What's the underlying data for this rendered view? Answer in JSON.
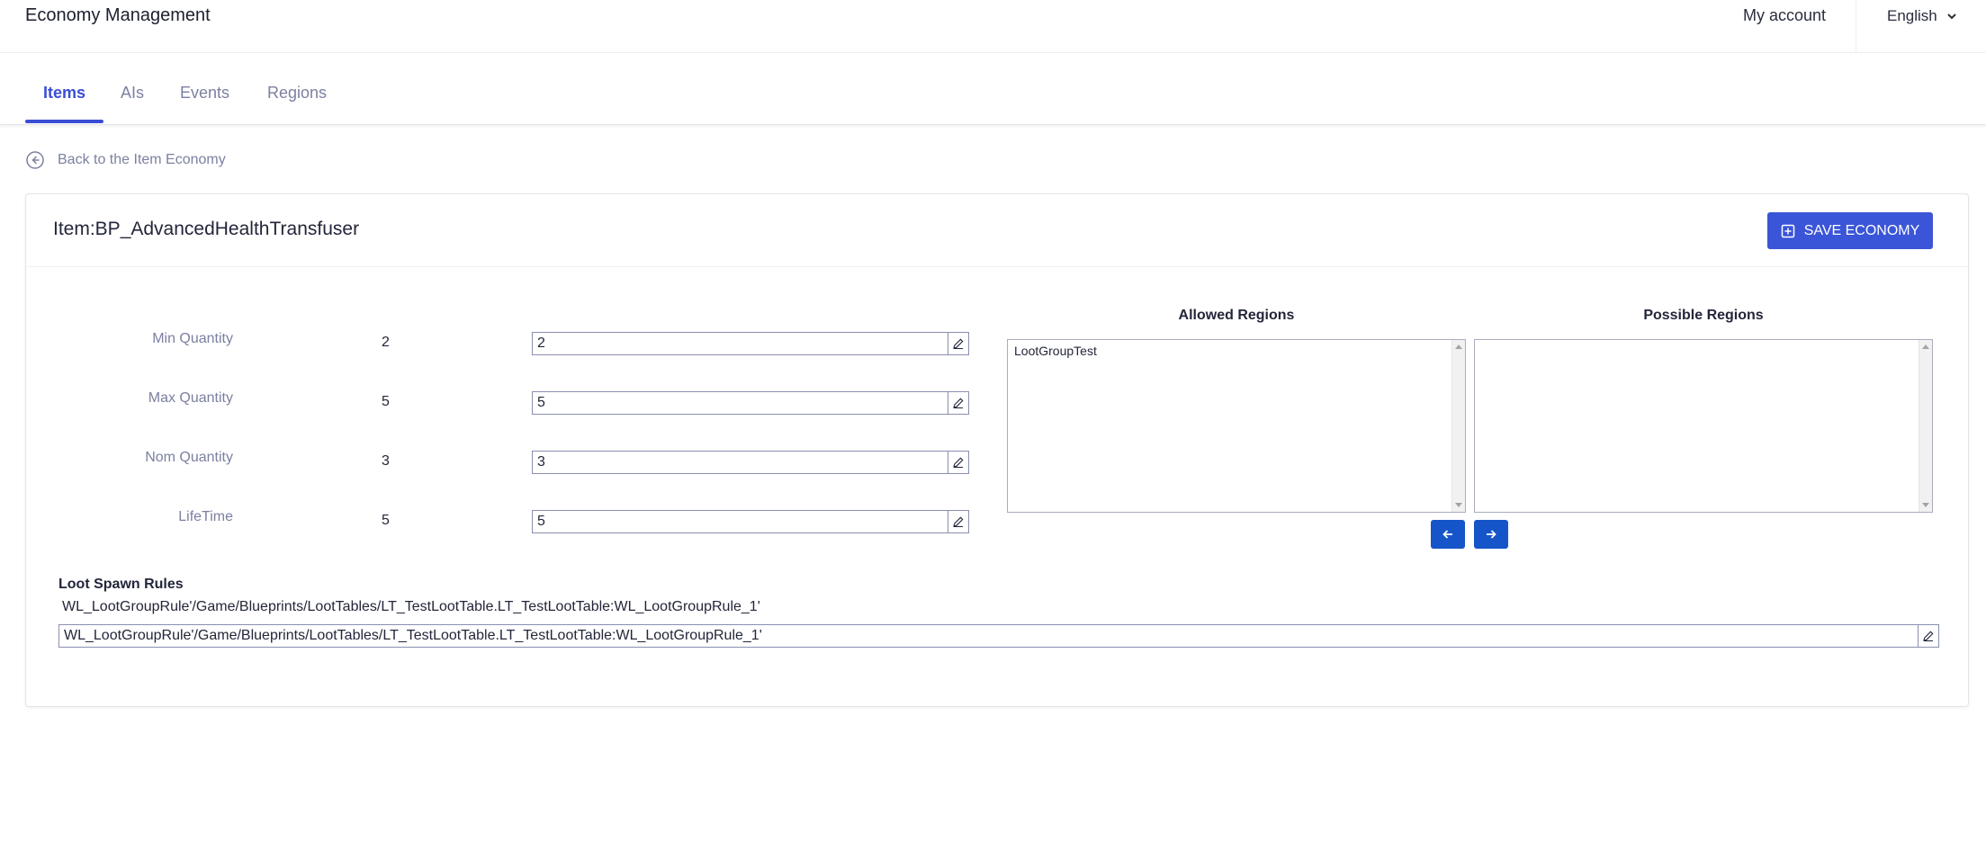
{
  "header": {
    "app_title": "Economy Management",
    "account_label": "My account",
    "language_label": "English"
  },
  "tabs": [
    {
      "label": "Items",
      "active": true
    },
    {
      "label": "AIs",
      "active": false
    },
    {
      "label": "Events",
      "active": false
    },
    {
      "label": "Regions",
      "active": false
    }
  ],
  "back_link": {
    "label": "Back to the Item Economy",
    "icon": "arrow-left-circle-icon"
  },
  "item": {
    "title": "Item:BP_AdvancedHealthTransfuser",
    "save_label": "SAVE ECONOMY"
  },
  "fields": [
    {
      "label": "Min Quantity",
      "value": "2",
      "input": "2"
    },
    {
      "label": "Max Quantity",
      "value": "5",
      "input": "5"
    },
    {
      "label": "Nom Quantity",
      "value": "3",
      "input": "3"
    },
    {
      "label": "LifeTime",
      "value": "5",
      "input": "5"
    }
  ],
  "regions": {
    "allowed_title": "Allowed Regions",
    "possible_title": "Possible Regions",
    "allowed_options": [
      "LootGroupTest"
    ],
    "possible_options": []
  },
  "loot_spawn": {
    "title": "Loot Spawn Rules",
    "text": "WL_LootGroupRule'/Game/Blueprints/LootTables/LT_TestLootTable.LT_TestLootTable:WL_LootGroupRule_1'",
    "input": "WL_LootGroupRule'/Game/Blueprints/LootTables/LT_TestLootTable.LT_TestLootTable:WL_LootGroupRule_1'"
  },
  "colors": {
    "accent": "#3a4ed5",
    "button": "#3a55d8",
    "arrow_button": "#1555c9"
  }
}
